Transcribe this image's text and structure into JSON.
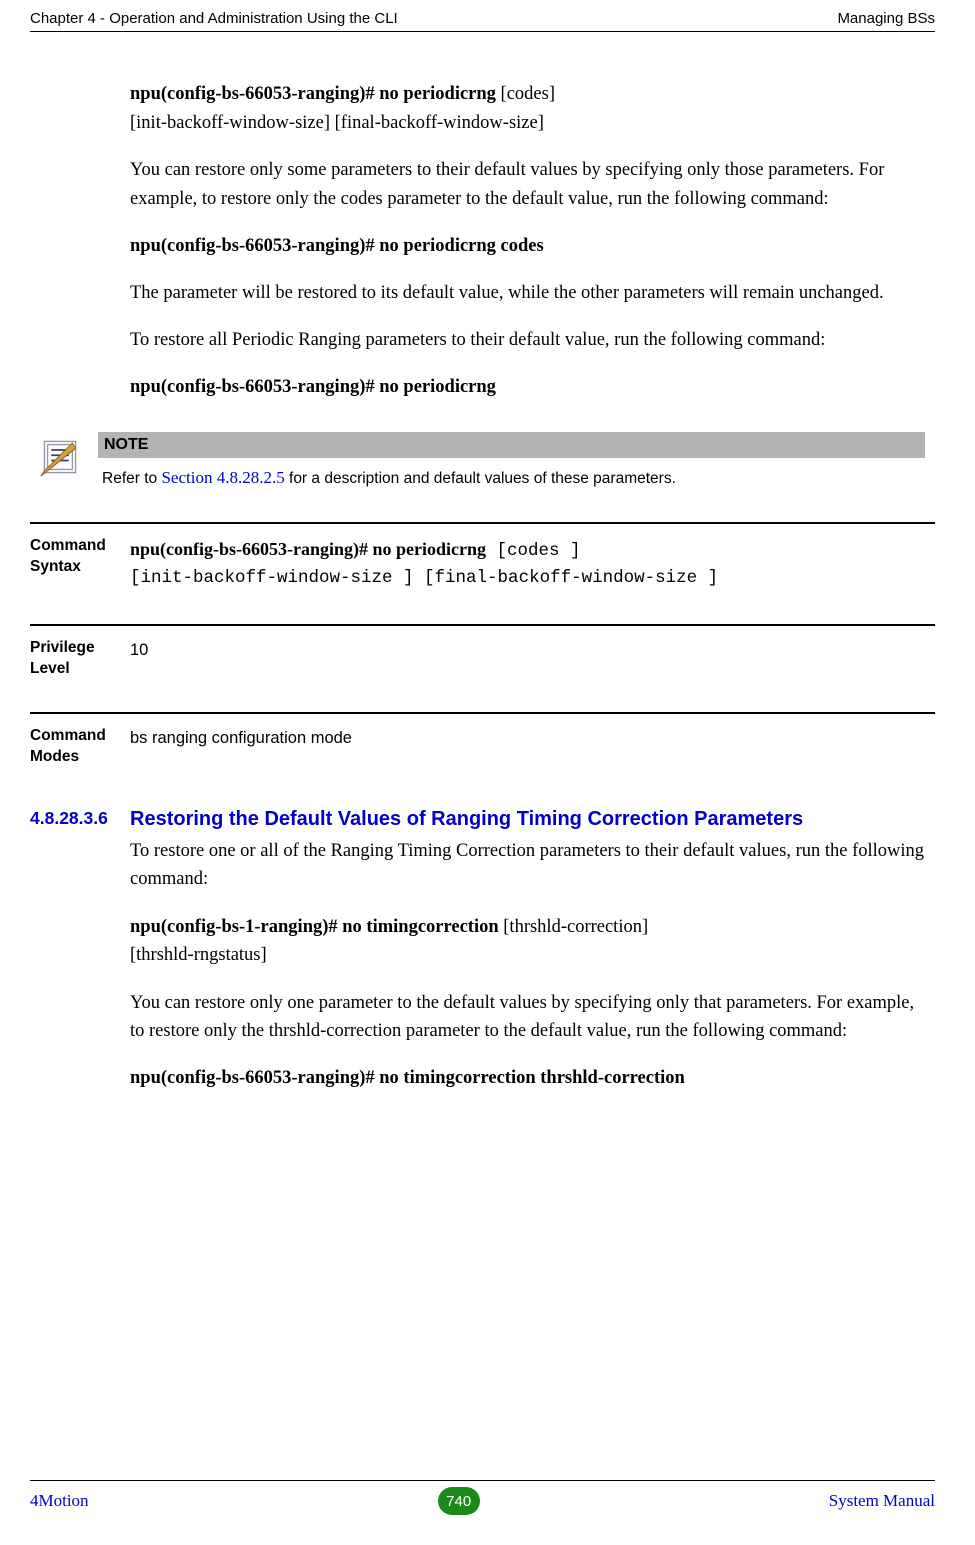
{
  "header": {
    "left": "Chapter 4 - Operation and Administration Using the CLI",
    "right": "Managing BSs"
  },
  "body": {
    "cmd1_bold": "npu(config-bs-66053-ranging)# no periodicrng ",
    "cmd1_rest": "[codes]",
    "cmd1_line2": "[init-backoff-window-size] [final-backoff-window-size]",
    "para1": "You can restore only some parameters to their default values by specifying only those parameters. For example, to restore only the codes parameter to the default value, run the following command:",
    "cmd2": "npu(config-bs-66053-ranging)# no periodicrng codes",
    "para2": "The parameter will be restored to its default value, while the other parameters will remain unchanged.",
    "para3": "To restore all Periodic Ranging parameters to their default value, run the following command:",
    "cmd3": "npu(config-bs-66053-ranging)# no periodicrng"
  },
  "note": {
    "title": "NOTE",
    "text_before": "Refer to ",
    "link": "Section 4.8.28.2.5",
    "text_after": " for a description and default values of these parameters."
  },
  "rows": {
    "syntax_label": "Command Syntax",
    "syntax_bold": "npu(config-bs-66053-ranging)# no periodicrng",
    "syntax_mono1": " [codes ] ",
    "syntax_mono2": "[init-backoff-window-size ] [final-backoff-window-size ]",
    "priv_label": "Privilege Level",
    "priv_value": "10",
    "modes_label": "Command Modes",
    "modes_value": "bs ranging configuration mode"
  },
  "section": {
    "num": "4.8.28.3.6",
    "title": "Restoring the Default Values of Ranging Timing Correction Parameters",
    "para1": "To restore one or all of the Ranging Timing Correction parameters to their default values, run the following command:",
    "cmd1_bold": "npu(config-bs-1-ranging)# no timingcorrection ",
    "cmd1_rest": "[thrshld-correction] ",
    "cmd1_line2": "[thrshld-rngstatus]",
    "para2": "You can restore only one parameter to the default values by specifying only that parameters. For example, to restore only the thrshld-correction parameter to the default value, run the following command:",
    "cmd2": "npu(config-bs-66053-ranging)# no timingcorrection thrshld-correction"
  },
  "footer": {
    "left": "4Motion",
    "page": "740",
    "right": "System Manual"
  }
}
